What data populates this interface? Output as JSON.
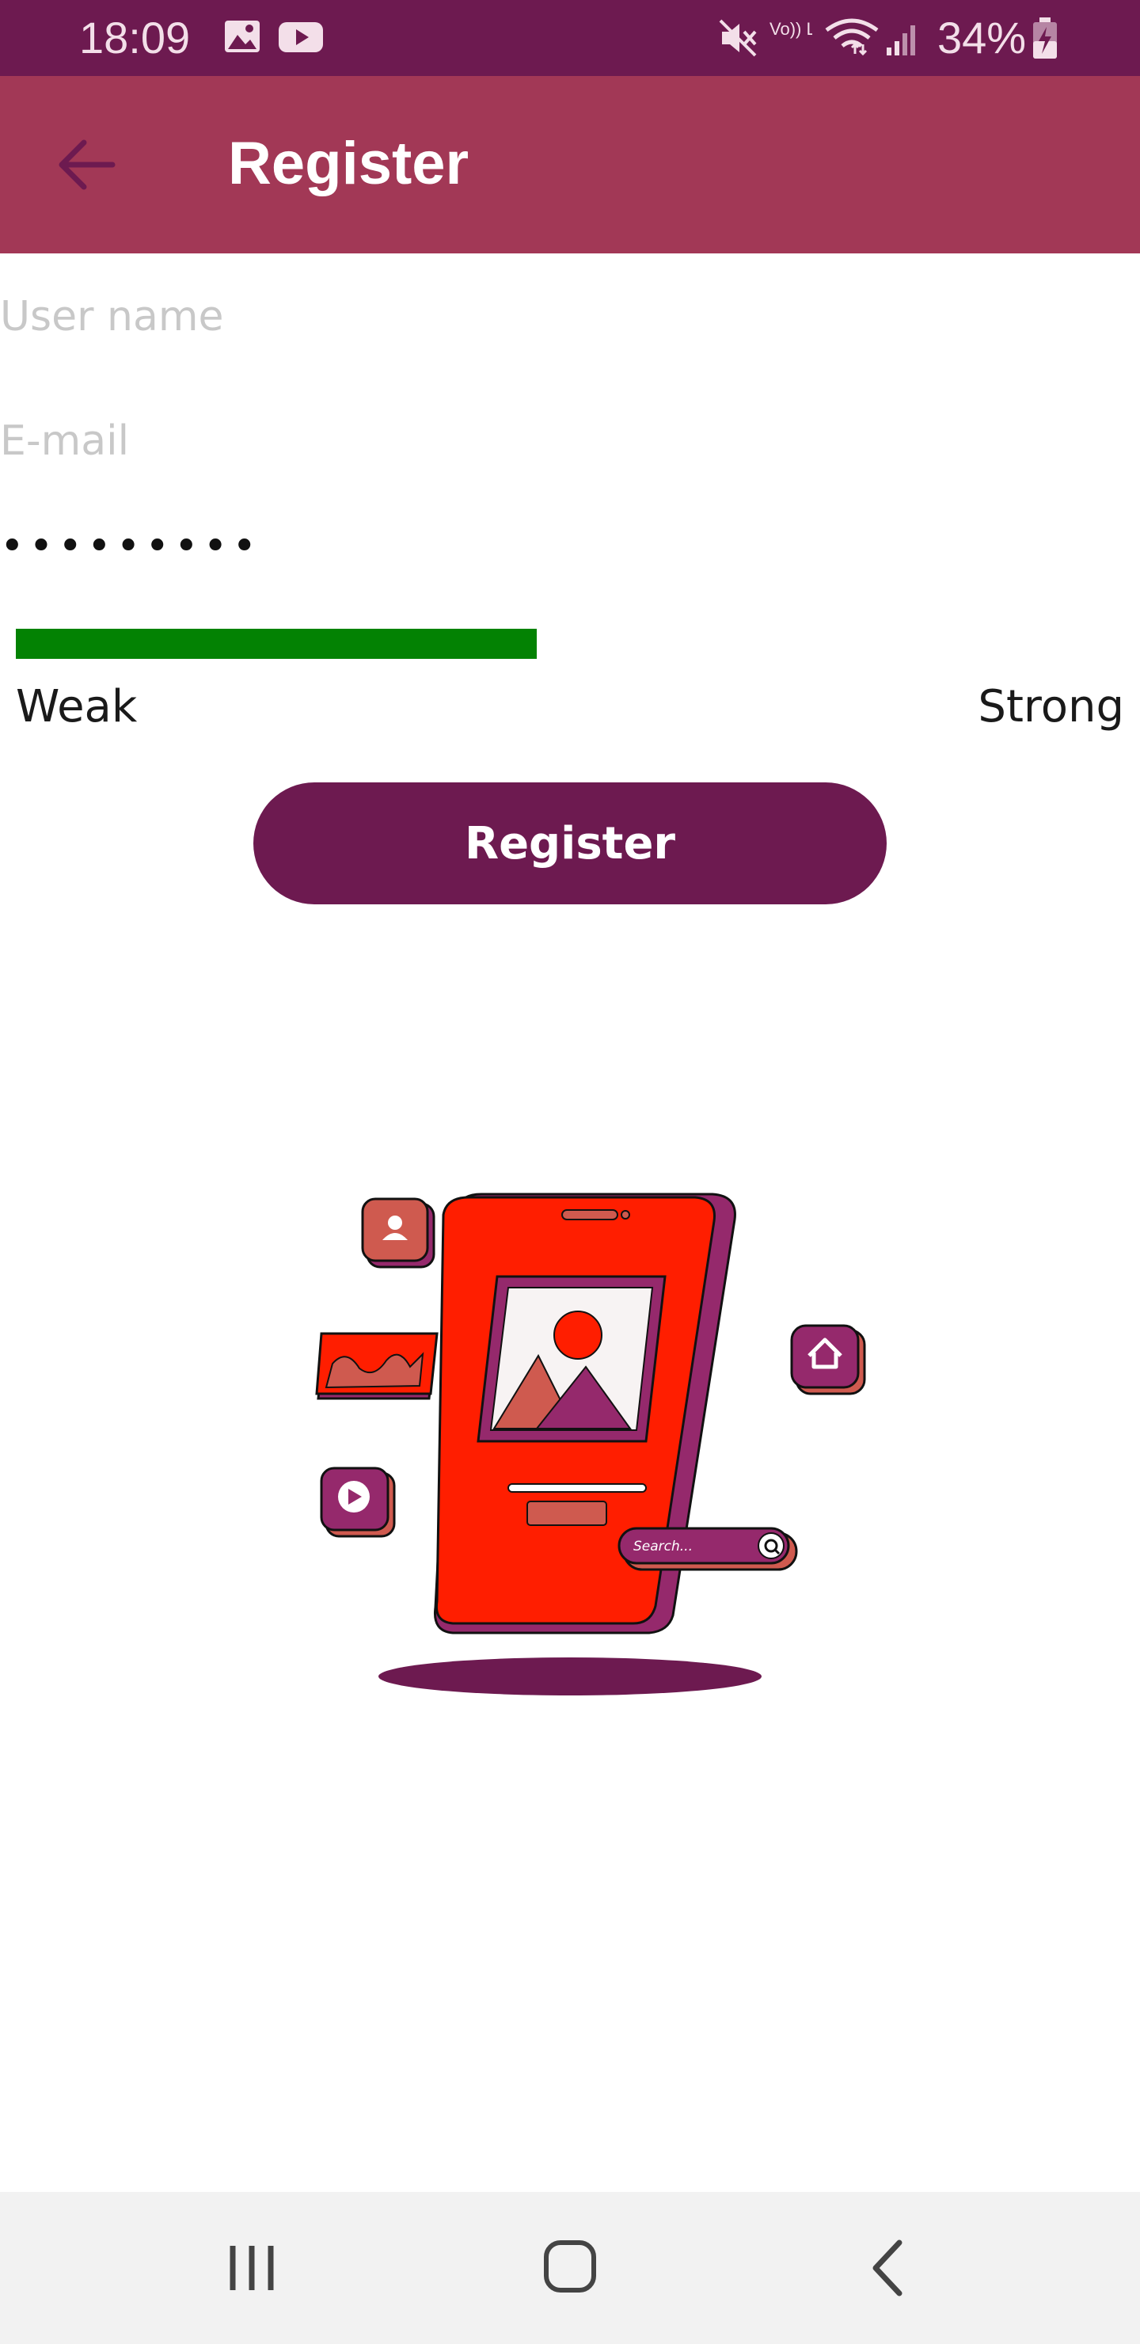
{
  "status_bar": {
    "time": "18:09",
    "battery": "34%",
    "icons": [
      "image-icon",
      "youtube-icon",
      "mute-icon",
      "volte-icon",
      "wifi-icon",
      "signal-icon",
      "battery-icon"
    ],
    "volte_label": "Vo)) LTE"
  },
  "app_bar": {
    "title": "Register",
    "back_icon": "arrow-back-icon"
  },
  "form": {
    "username_placeholder": "User name",
    "username_value": "",
    "email_placeholder": "E-mail",
    "email_value": "",
    "password_display": "•••••••••",
    "password_strength": 0.47,
    "strength_min_label": "Weak",
    "strength_max_label": "Strong",
    "register_label": "Register"
  },
  "illustration": {
    "search_text": "Search..."
  },
  "nav_bar": {
    "items": [
      "recent-apps-icon",
      "home-icon",
      "back-icon"
    ]
  },
  "colors": {
    "status_bar": "#6d1a50",
    "app_bar": "#a23856",
    "button": "#6d1a50",
    "strength_fill": "#038203",
    "placeholder": "#c8c8c8"
  }
}
